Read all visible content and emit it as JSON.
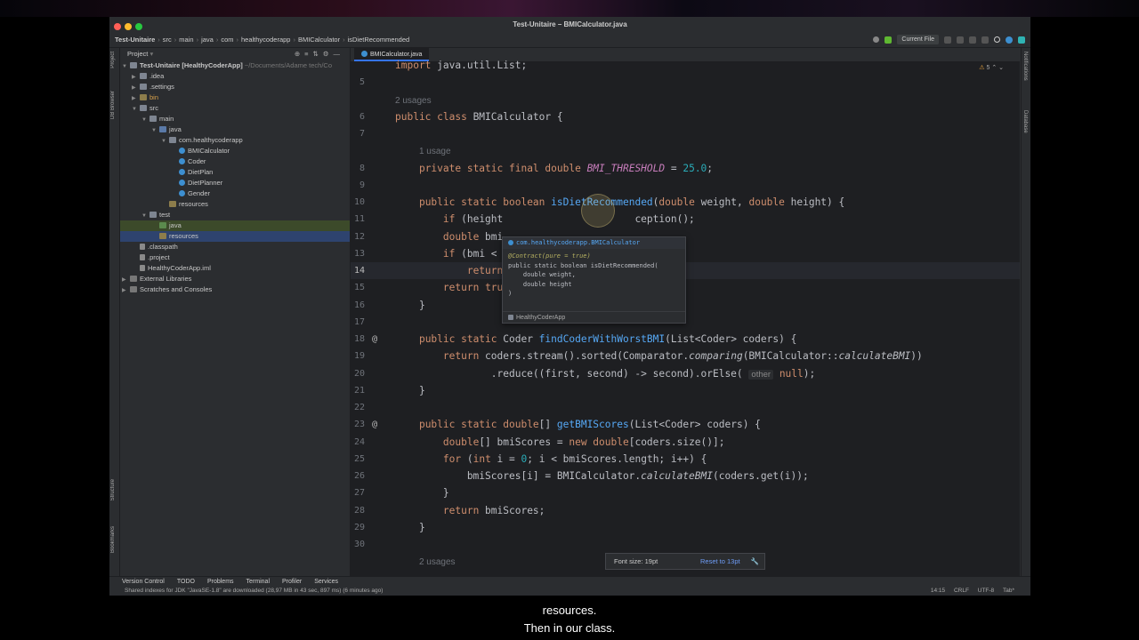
{
  "window": {
    "title": "Test-Unitaire – BMICalculator.java"
  },
  "breadcrumbs": [
    "Test-Unitaire",
    "src",
    "main",
    "java",
    "com",
    "healthycoderapp",
    "BMICalculator",
    "isDietRecommended"
  ],
  "toolbar": {
    "run_config": "Current File"
  },
  "left_toolwindows": [
    "Project",
    "DB Browser",
    "Structure",
    "Bookmarks"
  ],
  "right_toolwindows": [
    "Notifications",
    "Database"
  ],
  "project": {
    "title": "Project",
    "root": "Test-Unitaire [HealthyCoderApp]",
    "root_path": "~/Documents/Adame tech/Co",
    "nodes": [
      {
        "label": ".idea",
        "indent": 1,
        "type": "folder",
        "arrow": "▶"
      },
      {
        "label": ".settings",
        "indent": 1,
        "type": "folder",
        "arrow": "▶"
      },
      {
        "label": "bin",
        "indent": 1,
        "type": "res",
        "arrow": "▶",
        "orange": true
      },
      {
        "label": "src",
        "indent": 1,
        "type": "folder",
        "arrow": "▼"
      },
      {
        "label": "main",
        "indent": 2,
        "type": "folder",
        "arrow": "▼"
      },
      {
        "label": "java",
        "indent": 3,
        "type": "src",
        "arrow": "▼"
      },
      {
        "label": "com.healthycoderapp",
        "indent": 4,
        "type": "folder",
        "arrow": "▼"
      },
      {
        "label": "BMICalculator",
        "indent": 5,
        "type": "cls",
        "arrow": ""
      },
      {
        "label": "Coder",
        "indent": 5,
        "type": "cls",
        "arrow": ""
      },
      {
        "label": "DietPlan",
        "indent": 5,
        "type": "cls",
        "arrow": ""
      },
      {
        "label": "DietPlanner",
        "indent": 5,
        "type": "cls",
        "arrow": ""
      },
      {
        "label": "Gender",
        "indent": 5,
        "type": "cls",
        "arrow": ""
      },
      {
        "label": "resources",
        "indent": 4,
        "type": "res",
        "arrow": ""
      },
      {
        "label": "test",
        "indent": 2,
        "type": "folder",
        "arrow": "▼"
      },
      {
        "label": "java",
        "indent": 3,
        "type": "test",
        "arrow": "",
        "state": "hl"
      },
      {
        "label": "resources",
        "indent": 3,
        "type": "res",
        "arrow": "",
        "state": "sel"
      },
      {
        "label": ".classpath",
        "indent": 1,
        "type": "file",
        "arrow": ""
      },
      {
        "label": ".project",
        "indent": 1,
        "type": "file",
        "arrow": ""
      },
      {
        "label": "HealthyCoderApp.iml",
        "indent": 1,
        "type": "file",
        "arrow": ""
      },
      {
        "label": "External Libraries",
        "indent": 0,
        "type": "lib",
        "arrow": "▶"
      },
      {
        "label": "Scratches and Consoles",
        "indent": 0,
        "type": "lib",
        "arrow": "▶"
      }
    ]
  },
  "editor": {
    "tab": "BMICalculator.java",
    "inspections": {
      "warnings": "5"
    },
    "lines": [
      {
        "n": "",
        "html": "<span class=\"kw\">import</span> java.util.List;"
      },
      {
        "n": "5",
        "html": ""
      },
      {
        "n": "",
        "html": "<span class=\"hint\">2 usages</span>"
      },
      {
        "n": "6",
        "html": "<span class=\"kw\">public class</span> BMICalculator {"
      },
      {
        "n": "7",
        "html": ""
      },
      {
        "n": "",
        "html": "    <span class=\"hint\">1 usage</span>"
      },
      {
        "n": "8",
        "html": "    <span class=\"kw\">private static final double</span> <span class=\"fld\">BMI_THRESHOLD</span> = <span class=\"num\">25.0</span>;"
      },
      {
        "n": "9",
        "html": ""
      },
      {
        "n": "10",
        "html": "    <span class=\"kw\">public static boolean</span> <span class=\"fn\">isDietRecommended</span>(<span class=\"kw\">double</span> weight, <span class=\"kw\">double</span> height) {"
      },
      {
        "n": "11",
        "html": "        <span class=\"kw\">if</span> (height                      ception();"
      },
      {
        "n": "12",
        "html": "        <span class=\"kw\">double</span> bmi"
      },
      {
        "n": "13",
        "html": "        <span class=\"kw\">if</span> (bmi &lt;"
      },
      {
        "n": "14",
        "html": "            <span class=\"kw\">return</span>",
        "cur": true
      },
      {
        "n": "15",
        "html": "        <span class=\"kw\">return</span> <span class=\"kw\">tru</span>"
      },
      {
        "n": "16",
        "html": "    }"
      },
      {
        "n": "17",
        "html": ""
      },
      {
        "n": "18",
        "html": "    <span class=\"kw\">public static</span> Coder <span class=\"fn\">findCoderWithWorstBMI</span>(List&lt;Coder&gt; coders) {",
        "at": true
      },
      {
        "n": "19",
        "html": "        <span class=\"kw\">return</span> coders.stream().sorted(Comparator.<span class=\"it\">comparing</span>(BMICalculator::<span class=\"it\">calculateBMI</span>))"
      },
      {
        "n": "20",
        "html": "                .reduce((first, second) -&gt; second).orElse( <span class=\"inlay\">other</span> <span class=\"kw\">null</span>);"
      },
      {
        "n": "21",
        "html": "    }"
      },
      {
        "n": "22",
        "html": ""
      },
      {
        "n": "23",
        "html": "    <span class=\"kw\">public static double</span>[] <span class=\"fn\">getBMIScores</span>(List&lt;Coder&gt; coders) {",
        "at": true
      },
      {
        "n": "24",
        "html": "        <span class=\"kw\">double</span>[] bmiScores = <span class=\"kw\">new double</span>[coders.size()];"
      },
      {
        "n": "25",
        "html": "        <span class=\"kw\">for</span> (<span class=\"kw\">int</span> i = <span class=\"num\">0</span>; i &lt; bmiScores.length; i++) {"
      },
      {
        "n": "26",
        "html": "            bmiScores[i] = BMICalculator.<span class=\"it\">calculateBMI</span>(coders.get(i));"
      },
      {
        "n": "27",
        "html": "        }"
      },
      {
        "n": "28",
        "html": "        <span class=\"kw\">return</span> bmiScores;"
      },
      {
        "n": "29",
        "html": "    }"
      },
      {
        "n": "30",
        "html": ""
      },
      {
        "n": "",
        "html": "    <span class=\"hint\">2 usages</span>"
      }
    ]
  },
  "popup": {
    "header": "com.healthycoderapp.BMICalculator",
    "annotation": "@Contract(pure = true)",
    "signature": "public static boolean isDietRecommended(",
    "param1": "    double weight,",
    "param2": "    double height",
    "close": ")",
    "module": "HealthyCoderApp"
  },
  "bottom_tools": [
    "Version Control",
    "TODO",
    "Problems",
    "Terminal",
    "Profiler",
    "Services"
  ],
  "status": {
    "message": "Shared indexes for JDK \"JavaSE-1.8\" are downloaded (28,97 MB in 43 sec, 897 ms) (6 minutes ago)",
    "position": "14:15",
    "line_sep": "CRLF",
    "encoding": "UTF-8",
    "indent": "Tab*"
  },
  "font_popup": {
    "label": "Font size: 19pt",
    "reset": "Reset to 13pt"
  },
  "subtitles": [
    "resources.",
    "Then in our class."
  ]
}
